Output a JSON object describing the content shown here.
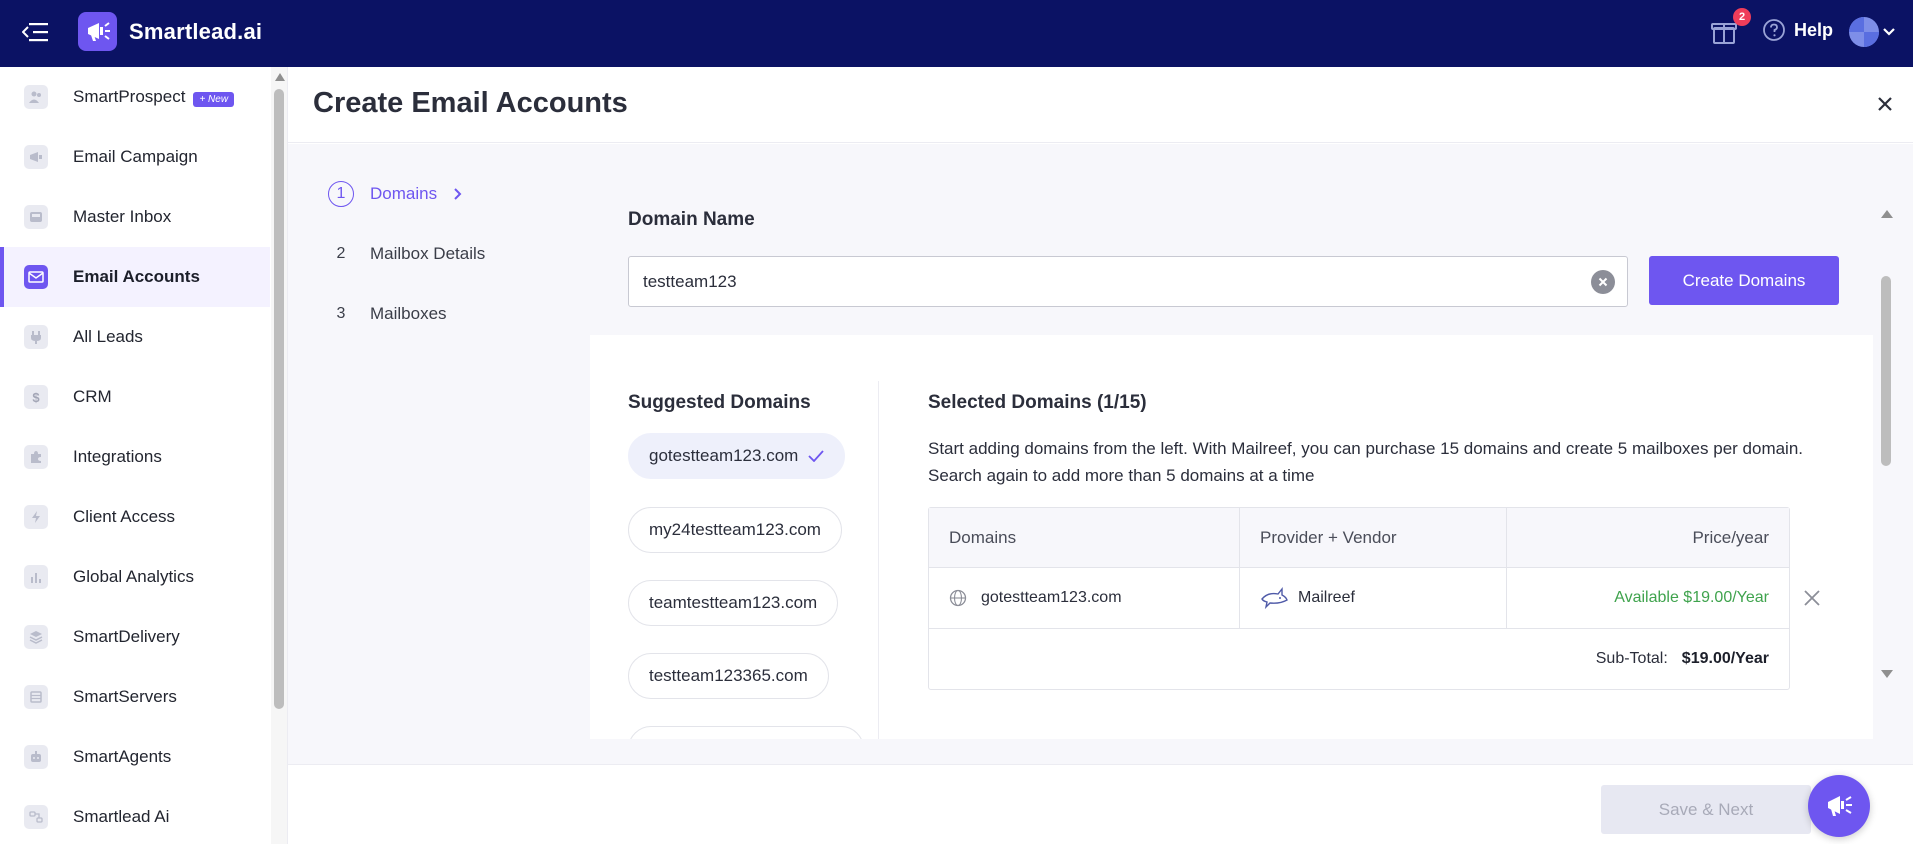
{
  "app": {
    "brand": "Smartlead.ai"
  },
  "header": {
    "notifications_count": "2",
    "help_label": "Help"
  },
  "sidebar": {
    "items": [
      {
        "label": "SmartProspect",
        "badge": "+ New"
      },
      {
        "label": "Email Campaign"
      },
      {
        "label": "Master Inbox"
      },
      {
        "label": "Email Accounts"
      },
      {
        "label": "All Leads"
      },
      {
        "label": "CRM"
      },
      {
        "label": "Integrations"
      },
      {
        "label": "Client Access"
      },
      {
        "label": "Global Analytics"
      },
      {
        "label": "SmartDelivery"
      },
      {
        "label": "SmartServers"
      },
      {
        "label": "SmartAgents"
      },
      {
        "label": "Smartlead Ai"
      }
    ]
  },
  "modal": {
    "title": "Create Email Accounts",
    "steps": [
      {
        "num": "1",
        "label": "Domains"
      },
      {
        "num": "2",
        "label": "Mailbox Details"
      },
      {
        "num": "3",
        "label": "Mailboxes"
      }
    ],
    "domain_name_label": "Domain Name",
    "domain_input_value": "testteam123",
    "create_button": "Create Domains",
    "suggested_title": "Suggested Domains",
    "suggested": [
      "gotestteam123.com",
      "my24testteam123.com",
      "teamtestteam123.com",
      "testteam123365.com"
    ],
    "selected_title": "Selected Domains (1/15)",
    "selected_description": "Start adding domains from the left. With Mailreef, you can purchase 15 domains and create 5 mailboxes per domain. Search again to add more than 5 domains at a time",
    "table": {
      "headers": [
        "Domains",
        "Provider + Vendor",
        "Price/year"
      ],
      "rows": [
        {
          "domain": "gotestteam123.com",
          "vendor": "Mailreef",
          "price": "Available $19.00/Year"
        }
      ],
      "subtotal_label": "Sub-Total:",
      "subtotal_value": "$19.00/Year"
    },
    "save_button": "Save & Next"
  },
  "colors": {
    "navbar": "#0b1264",
    "accent": "#6e56f0",
    "available": "#3fa34d"
  }
}
